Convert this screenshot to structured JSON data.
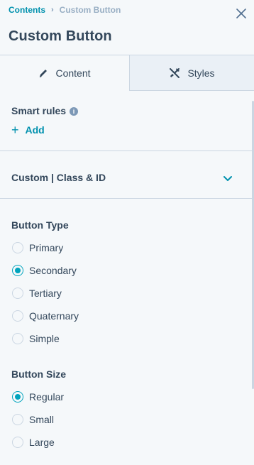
{
  "header": {
    "breadcrumb": [
      "Contents",
      "Custom Button"
    ],
    "title": "Custom Button",
    "close_icon": "close-icon"
  },
  "tabs": [
    {
      "label": "Content",
      "icon": "pencil-icon",
      "active": true
    },
    {
      "label": "Styles",
      "icon": "styles-icon",
      "active": false
    }
  ],
  "smart_rules": {
    "label": "Smart rules",
    "info": "i",
    "add_label": "Add"
  },
  "accordion": {
    "label": "Custom | Class & ID"
  },
  "button_type": {
    "label": "Button Type",
    "options": [
      "Primary",
      "Secondary",
      "Tertiary",
      "Quaternary",
      "Simple"
    ],
    "selected": "Secondary"
  },
  "button_size": {
    "label": "Button Size",
    "options": [
      "Regular",
      "Small",
      "Large"
    ],
    "selected": "Regular"
  },
  "colors": {
    "accent": "#00a4bd",
    "link": "#0091ae",
    "text": "#33475b",
    "border": "#cbd6e2",
    "background": "#f5f8fa",
    "inactive_tab": "#eaf0f6"
  }
}
